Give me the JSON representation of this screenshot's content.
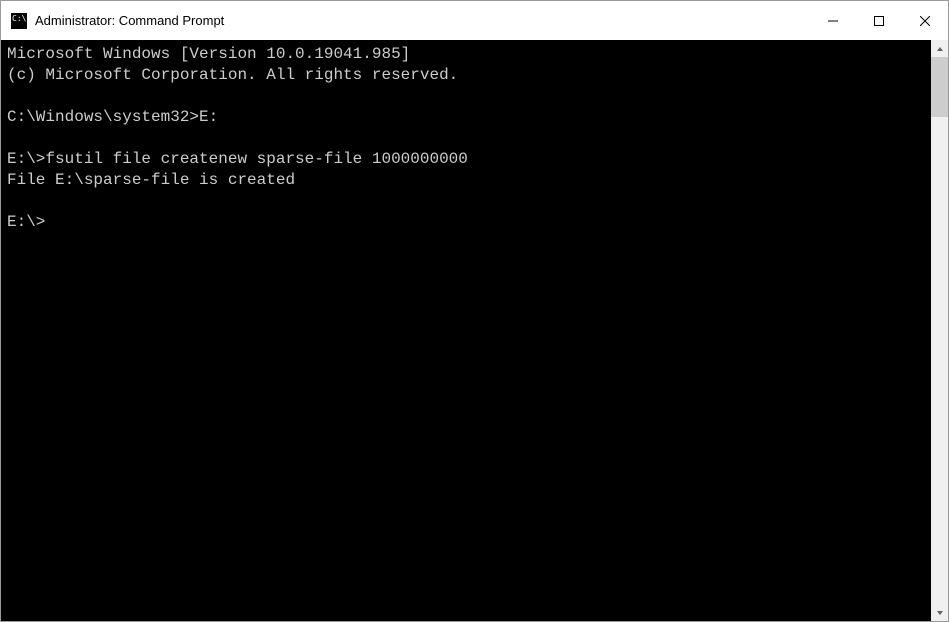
{
  "window": {
    "title": "Administrator: Command Prompt"
  },
  "terminal": {
    "lines": [
      "Microsoft Windows [Version 10.0.19041.985]",
      "(c) Microsoft Corporation. All rights reserved.",
      "",
      "C:\\Windows\\system32>E:",
      "",
      "E:\\>fsutil file createnew sparse-file 1000000000",
      "File E:\\sparse-file is created",
      "",
      "E:\\>"
    ]
  }
}
